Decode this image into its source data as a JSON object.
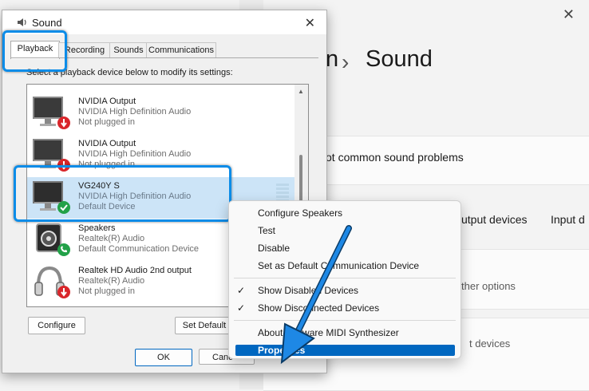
{
  "background": {
    "close_glyph": "✕",
    "breadcrumb_chevron": "›",
    "page_title_fragment": "n",
    "page_title": "Sound",
    "troubleshoot_text": "ot common sound problems",
    "output_devices_tab": "utput devices",
    "input_devices_tab": "Input d",
    "other_options_text": "ther options",
    "devices_text": "t devices"
  },
  "dialog": {
    "title": "Sound",
    "close_glyph": "✕",
    "tabs": [
      "Playback",
      "Recording",
      "Sounds",
      "Communications"
    ],
    "active_tab": "Playback",
    "instruction": "Select a playback device below to modify its settings:",
    "devices": [
      {
        "name": "NVIDIA Output",
        "driver": "NVIDIA High Definition Audio",
        "status": "Not plugged in",
        "icon": "monitor-icon",
        "badge": "unplugged-badge-icon"
      },
      {
        "name": "NVIDIA Output",
        "driver": "NVIDIA High Definition Audio",
        "status": "Not plugged in",
        "icon": "monitor-icon",
        "badge": "unplugged-badge-icon"
      },
      {
        "name": "VG240Y S",
        "driver": "NVIDIA High Definition Audio",
        "status": "Default Device",
        "icon": "monitor-icon",
        "badge": "default-check-badge-icon",
        "selected": true
      },
      {
        "name": "Speakers",
        "driver": "Realtek(R) Audio",
        "status": "Default Communication Device",
        "icon": "speaker-icon",
        "badge": "phone-badge-icon"
      },
      {
        "name": "Realtek HD Audio 2nd output",
        "driver": "Realtek(R) Audio",
        "status": "Not plugged in",
        "icon": "headphones-icon",
        "badge": "unplugged-badge-icon"
      }
    ],
    "configure_button": "Configure",
    "set_default_button": "Set Default",
    "ok_button": "OK",
    "cancel_button": "Canc"
  },
  "context_menu": {
    "items": [
      {
        "label": "Configure Speakers",
        "checked": false
      },
      {
        "label": "Test",
        "checked": false
      },
      {
        "label": "Disable",
        "checked": false
      },
      {
        "label": "Set as Default Communication Device",
        "checked": false
      },
      {
        "label": "Show Disabled Devices",
        "checked": true
      },
      {
        "label": "Show Disconnected Devices",
        "checked": true
      },
      {
        "label": "About Software MIDI Synthesizer",
        "checked": false
      },
      {
        "label": "Properties",
        "highlighted": true
      }
    ],
    "check_glyph": "✓"
  },
  "colors": {
    "highlight_frame": "#0b8ce8",
    "selection": "#cce4f7",
    "menu_highlight": "#0067c0",
    "unplugged_badge": "#d9262b",
    "default_badge": "#22a148",
    "arrow": "#1e88e5"
  }
}
